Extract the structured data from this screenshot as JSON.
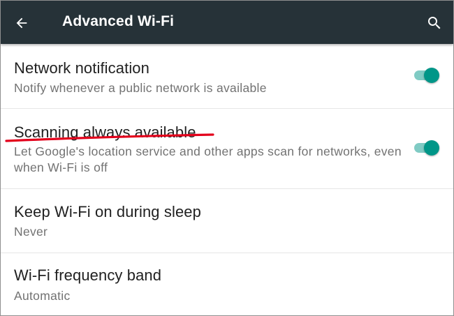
{
  "colors": {
    "toolbar_bg": "#263238",
    "accent": "#009688",
    "accent_track": "#80cbc4",
    "annotation": "#e3001b"
  },
  "toolbar": {
    "back_icon": "arrow-left-icon",
    "title": "Advanced Wi-Fi",
    "search_icon": "search-icon"
  },
  "settings": [
    {
      "title": "Network notification",
      "summary": "Notify whenever a public network is available",
      "toggle": true,
      "checked": true
    },
    {
      "title": "Scanning always available",
      "summary": "Let Google's location service and other apps scan for networks, even when Wi-Fi is off",
      "toggle": true,
      "checked": true
    },
    {
      "title": "Keep Wi-Fi on during sleep",
      "summary": "Never",
      "toggle": false
    },
    {
      "title": "Wi-Fi frequency band",
      "summary": "Automatic",
      "toggle": false
    }
  ]
}
